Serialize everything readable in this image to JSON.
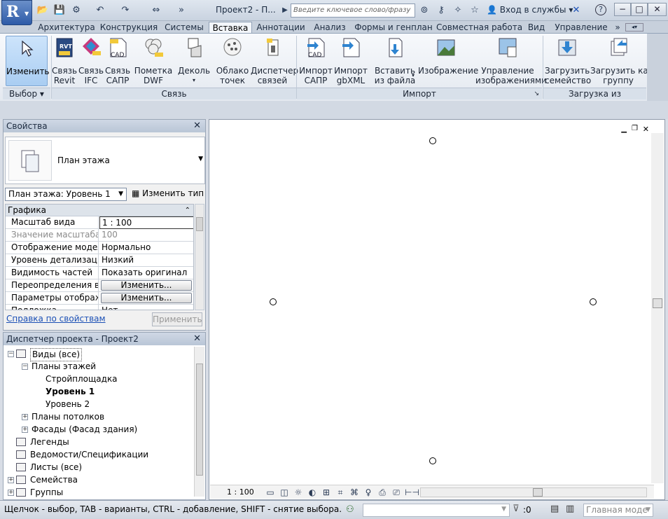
{
  "title_bar": {
    "app_letter": "R",
    "doc_title": "Проект2 - П...",
    "search_placeholder": "Введите ключевое слово/фразу",
    "login_label": "Вход в службы",
    "help_glyph": "?"
  },
  "tabs": [
    "Архитектура",
    "Конструкция",
    "Системы",
    "Вставка",
    "Аннотации",
    "Анализ",
    "Формы и генплан",
    "Совместная работа",
    "Вид",
    "Управление"
  ],
  "active_tab": "Вставка",
  "ribbon": {
    "modify": {
      "label": "Изменить"
    },
    "select_panel": "Выбор",
    "link_panel": "Связь",
    "import_panel": "Импорт",
    "library_panel": "Загрузка из библиотеки",
    "buttons": [
      {
        "id": "link-revit",
        "line1": "Связь",
        "line2": "Revit",
        "icon_text": "RVT"
      },
      {
        "id": "link-ifc",
        "line1": "Связь",
        "line2": "IFC",
        "icon_text": ""
      },
      {
        "id": "link-cad",
        "line1": "Связь",
        "line2": "САПР",
        "icon_text": "CAD"
      },
      {
        "id": "dwf-markup",
        "line1": "Пометка",
        "line2": "DWF",
        "icon_text": ""
      },
      {
        "id": "decal",
        "line1": "Деколь",
        "line2": "",
        "icon_text": ""
      },
      {
        "id": "point-cloud",
        "line1": "Облако",
        "line2": "точек",
        "icon_text": ""
      },
      {
        "id": "manage-links",
        "line1": "Диспетчер",
        "line2": "связей",
        "icon_text": ""
      },
      {
        "id": "import-cad",
        "line1": "Импорт",
        "line2": "САПР",
        "icon_text": "CAD"
      },
      {
        "id": "import-gbxml",
        "line1": "Импорт",
        "line2": "gbXML",
        "icon_text": ""
      },
      {
        "id": "insert-from-file",
        "line1": "Вставить",
        "line2": "из файла",
        "icon_text": ""
      },
      {
        "id": "image",
        "line1": "Изображение",
        "line2": "",
        "icon_text": ""
      },
      {
        "id": "manage-images",
        "line1": "Управление",
        "line2": "изображениями",
        "icon_text": ""
      },
      {
        "id": "load-family",
        "line1": "Загрузить",
        "line2": "семейство",
        "icon_text": ""
      },
      {
        "id": "load-as-group",
        "line1": "Загрузить как",
        "line2": "группу",
        "icon_text": ""
      }
    ]
  },
  "properties": {
    "title": "Свойства",
    "type_name": "План этажа",
    "level_select": "План этажа: Уровень 1",
    "edit_type": "Изменить тип",
    "section": "Графика",
    "rows": [
      {
        "k": "Масштаб вида",
        "v": "1 : 100"
      },
      {
        "k": "Значение масштаба ...",
        "v": "100"
      },
      {
        "k": "Отображение модели",
        "v": "Нормально"
      },
      {
        "k": "Уровень детализации",
        "v": "Низкий"
      },
      {
        "k": "Видимость частей",
        "v": "Показать оригинал"
      },
      {
        "k": "Переопределения в...",
        "v": "Изменить..."
      },
      {
        "k": "Параметры отображ...",
        "v": "Изменить..."
      },
      {
        "k": "Подложка",
        "v": "Нет"
      }
    ],
    "help_link": "Справка по свойствам",
    "apply": "Применить"
  },
  "browser": {
    "title": "Диспетчер проекта - Проект2",
    "items": [
      {
        "label": "Виды (все)",
        "level": 0,
        "toggle": "−",
        "bold": false
      },
      {
        "label": "Планы этажей",
        "level": 1,
        "toggle": "−",
        "bold": false
      },
      {
        "label": "Стройплощадка",
        "level": 2,
        "toggle": "",
        "bold": false
      },
      {
        "label": "Уровень 1",
        "level": 2,
        "toggle": "",
        "bold": true
      },
      {
        "label": "Уровень 2",
        "level": 2,
        "toggle": "",
        "bold": false
      },
      {
        "label": "Планы потолков",
        "level": 1,
        "toggle": "+",
        "bold": false
      },
      {
        "label": "Фасады (Фасад здания)",
        "level": 1,
        "toggle": "+",
        "bold": false
      },
      {
        "label": "Легенды",
        "level": 0,
        "toggle": "",
        "bold": false
      },
      {
        "label": "Ведомости/Спецификации",
        "level": 0,
        "toggle": "",
        "bold": false
      },
      {
        "label": "Листы (все)",
        "level": 0,
        "toggle": "",
        "bold": false
      },
      {
        "label": "Семейства",
        "level": 0,
        "toggle": "+",
        "bold": false
      },
      {
        "label": "Группы",
        "level": 0,
        "toggle": "+",
        "bold": false
      }
    ]
  },
  "view": {
    "scale": "1 : 100"
  },
  "status": {
    "text": "Щелчок - выбор, TAB - варианты, CTRL - добавление, SHIFT - снятие выбора.",
    "filter_count": ":0",
    "model": "Главная моде"
  },
  "colors": {
    "accent": "#2e5ba8",
    "active_btn": "#a9cdf2",
    "link": "#1a4fb5"
  }
}
